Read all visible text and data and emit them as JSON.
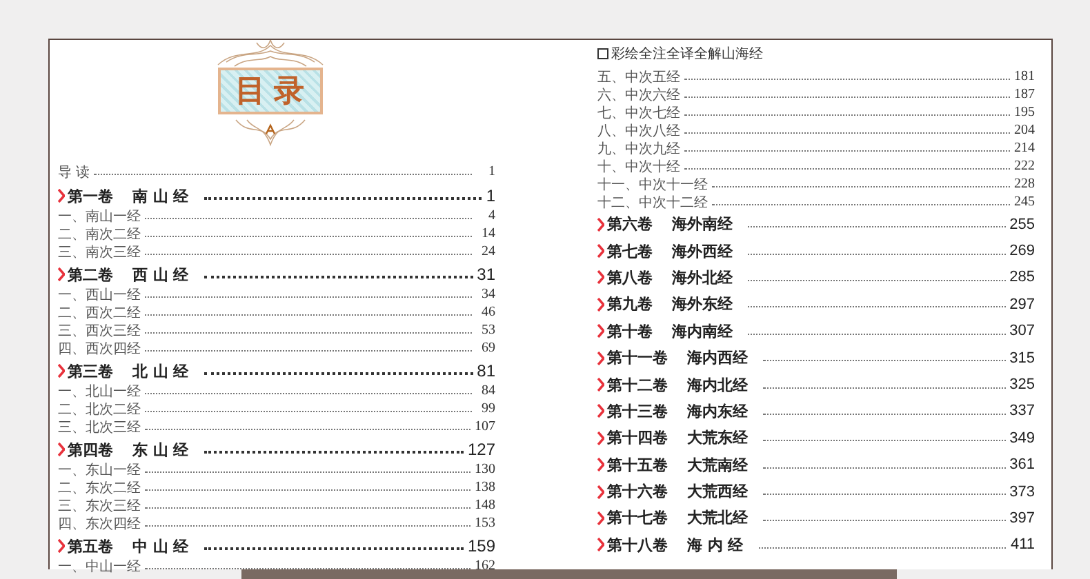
{
  "left_page": {
    "title": "目录",
    "entries": [
      {
        "kind": "intro",
        "label": "导 读",
        "page": "1"
      },
      {
        "kind": "volume",
        "number": "第一卷",
        "name": "南 山 经",
        "page": "1"
      },
      {
        "kind": "section",
        "label": "一、南山一经",
        "page": "4"
      },
      {
        "kind": "section",
        "label": "二、南次二经",
        "page": "14"
      },
      {
        "kind": "section",
        "label": "三、南次三经",
        "page": "24"
      },
      {
        "kind": "volume",
        "number": "第二卷",
        "name": "西 山 经",
        "page": "31"
      },
      {
        "kind": "section",
        "label": "一、西山一经",
        "page": "34"
      },
      {
        "kind": "section",
        "label": "二、西次二经",
        "page": "46"
      },
      {
        "kind": "section",
        "label": "三、西次三经",
        "page": "53"
      },
      {
        "kind": "section",
        "label": "四、西次四经",
        "page": "69"
      },
      {
        "kind": "volume",
        "number": "第三卷",
        "name": "北 山 经",
        "page": "81"
      },
      {
        "kind": "section",
        "label": "一、北山一经",
        "page": "84"
      },
      {
        "kind": "section",
        "label": "二、北次二经",
        "page": "99"
      },
      {
        "kind": "section",
        "label": "三、北次三经",
        "page": "107"
      },
      {
        "kind": "volume",
        "number": "第四卷",
        "name": "东 山 经",
        "page": "127"
      },
      {
        "kind": "section",
        "label": "一、东山一经",
        "page": "130"
      },
      {
        "kind": "section",
        "label": "二、东次二经",
        "page": "138"
      },
      {
        "kind": "section",
        "label": "三、东次三经",
        "page": "148"
      },
      {
        "kind": "section",
        "label": "四、东次四经",
        "page": "153"
      },
      {
        "kind": "volume",
        "number": "第五卷",
        "name": "中 山 经",
        "page": "159"
      },
      {
        "kind": "section",
        "label": "一、中山一经",
        "page": "162"
      }
    ]
  },
  "right_page": {
    "header": "彩绘全注全译全解山海经",
    "entries": [
      {
        "kind": "section",
        "label": "五、中次五经",
        "page": "181"
      },
      {
        "kind": "section",
        "label": "六、中次六经",
        "page": "187"
      },
      {
        "kind": "section",
        "label": "七、中次七经",
        "page": "195"
      },
      {
        "kind": "section",
        "label": "八、中次八经",
        "page": "204"
      },
      {
        "kind": "section",
        "label": "九、中次九经",
        "page": "214"
      },
      {
        "kind": "section",
        "label": "十、中次十经",
        "page": "222"
      },
      {
        "kind": "section",
        "label": "十一、中次十一经",
        "page": "228"
      },
      {
        "kind": "section",
        "label": "十二、中次十二经",
        "page": "245"
      },
      {
        "kind": "volume",
        "number": "第六卷",
        "name": "海外南经",
        "page": "255"
      },
      {
        "kind": "volume",
        "number": "第七卷",
        "name": "海外西经",
        "page": "269"
      },
      {
        "kind": "volume",
        "number": "第八卷",
        "name": "海外北经",
        "page": "285"
      },
      {
        "kind": "volume",
        "number": "第九卷",
        "name": "海外东经",
        "page": "297"
      },
      {
        "kind": "volume",
        "number": "第十卷",
        "name": "海内南经",
        "page": "307"
      },
      {
        "kind": "volume",
        "number": "第十一卷",
        "name": "海内西经",
        "page": "315"
      },
      {
        "kind": "volume",
        "number": "第十二卷",
        "name": "海内北经",
        "page": "325"
      },
      {
        "kind": "volume",
        "number": "第十三卷",
        "name": "海内东经",
        "page": "337"
      },
      {
        "kind": "volume",
        "number": "第十四卷",
        "name": "大荒东经",
        "page": "349"
      },
      {
        "kind": "volume",
        "number": "第十五卷",
        "name": "大荒南经",
        "page": "361"
      },
      {
        "kind": "volume",
        "number": "第十六卷",
        "name": "大荒西经",
        "page": "373"
      },
      {
        "kind": "volume",
        "number": "第十七卷",
        "name": "大荒北经",
        "page": "397"
      },
      {
        "kind": "volume",
        "number": "第十八卷",
        "name": "海 内 经",
        "page": "411"
      }
    ]
  }
}
